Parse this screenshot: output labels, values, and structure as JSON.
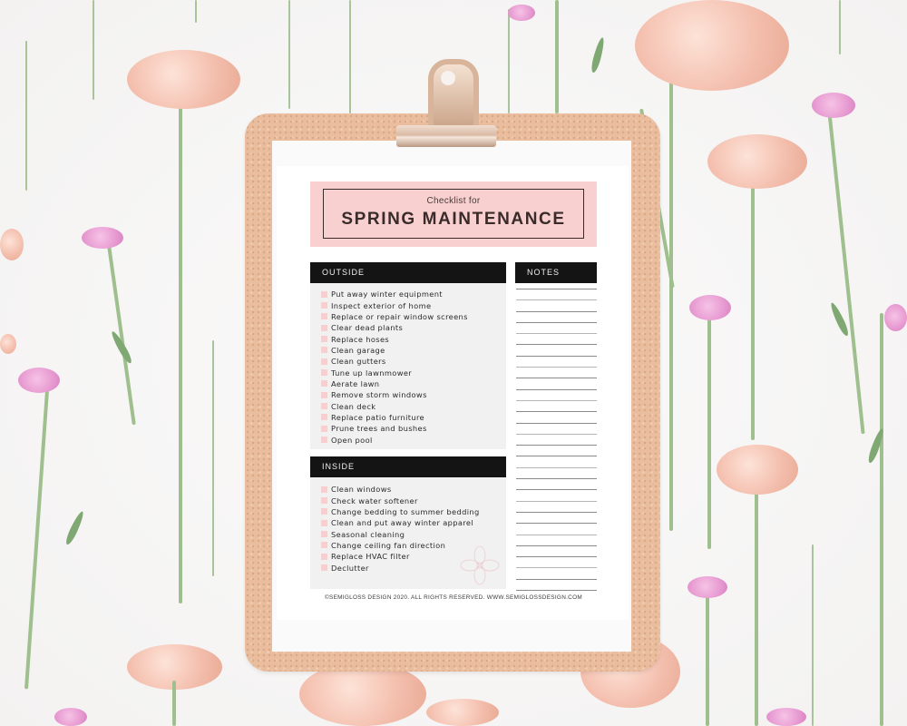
{
  "checklist": {
    "subtitle": "Checklist for",
    "title": "SPRING MAINTENANCE",
    "sections": {
      "outside": {
        "heading": "OUTSIDE",
        "items": [
          "Put away winter equipment",
          "Inspect exterior of home",
          "Replace or repair window screens",
          "Clear dead plants",
          "Replace hoses",
          "Clean garage",
          "Clean gutters",
          "Tune up lawnmower",
          "Aerate lawn",
          "Remove storm windows",
          "Clean deck",
          "Replace patio furniture",
          "Prune trees and bushes",
          "Open pool"
        ]
      },
      "inside": {
        "heading": "INSIDE",
        "items": [
          "Clean windows",
          "Check water softener",
          "Change bedding to summer bedding",
          "Clean and put away winter apparel",
          "Seasonal cleaning",
          "Change ceiling fan direction",
          "Replace HVAC filter",
          "Declutter"
        ]
      },
      "notes": {
        "heading": "NOTES",
        "line_count": 28
      }
    },
    "footer": "©SEMIGLOSS DESIGN 2020. ALL RIGHTS RESERVED. WWW.SEMIGLOSSDESIGN.COM"
  },
  "colors": {
    "title_band": "#f9d0d0",
    "section_header": "#141414",
    "section_body": "#f1f1f1",
    "checkbox": "#f6cfd1",
    "cork": "#e9bd9d"
  },
  "scene": {
    "objects": [
      "clipboard-icon",
      "binder-clip-icon",
      "flower-icon"
    ]
  }
}
